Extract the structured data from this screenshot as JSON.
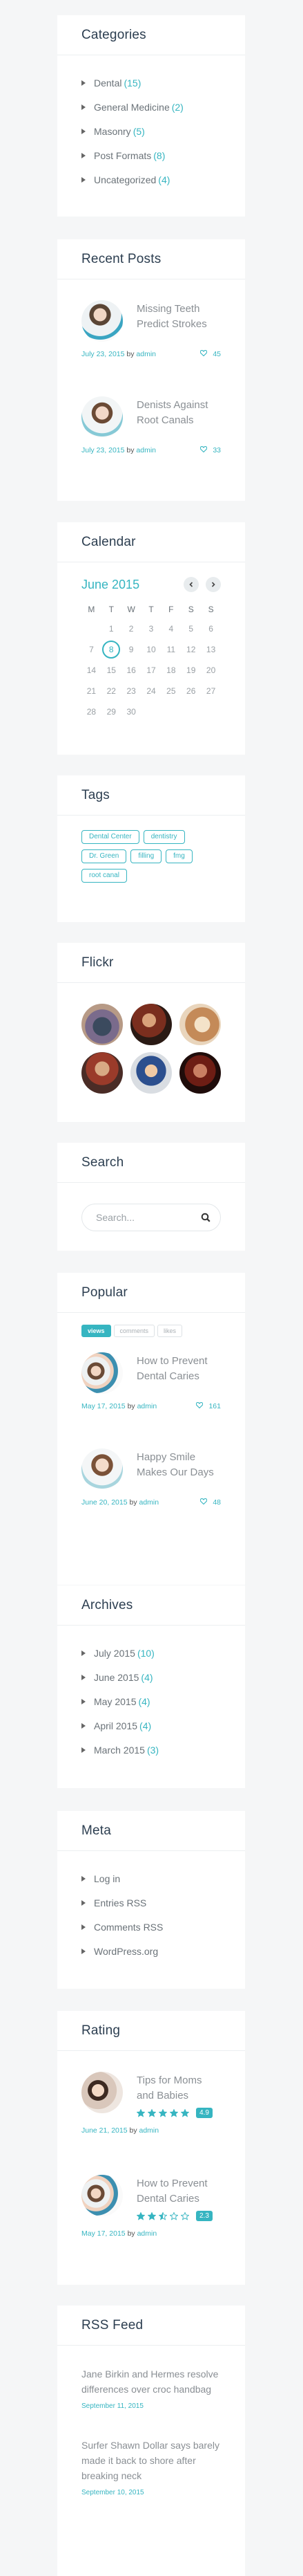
{
  "categories": {
    "title": "Categories",
    "items": [
      {
        "label": "Dental",
        "count": "(15)"
      },
      {
        "label": "General Medicine",
        "count": "(2)"
      },
      {
        "label": "Masonry",
        "count": "(5)"
      },
      {
        "label": "Post Formats",
        "count": "(8)"
      },
      {
        "label": "Uncategorized",
        "count": "(4)"
      }
    ]
  },
  "recent_posts": {
    "title": "Recent Posts",
    "posts": [
      {
        "title": "Missing Teeth Predict Strokes",
        "date": "July 23, 2015",
        "by": "by",
        "author": "admin",
        "likes": "45"
      },
      {
        "title": "Denists Against Root Canals",
        "date": "July 23, 2015",
        "by": "by",
        "author": "admin",
        "likes": "33"
      }
    ]
  },
  "calendar": {
    "title": "Calendar",
    "month": "June 2015",
    "prev_icon": "chevron-left-icon",
    "next_icon": "chevron-right-icon",
    "day_names": [
      "M",
      "T",
      "W",
      "T",
      "F",
      "S",
      "S"
    ],
    "weeks": [
      [
        "",
        "",
        "",
        "",
        "",
        "",
        ""
      ],
      [
        "",
        "1",
        "2",
        "3",
        "4",
        "5",
        "6"
      ],
      [
        "7",
        "8",
        "9",
        "10",
        "11",
        "12",
        "13"
      ],
      [
        "14",
        "15",
        "16",
        "17",
        "18",
        "19",
        "20"
      ],
      [
        "21",
        "22",
        "23",
        "24",
        "25",
        "26",
        "27"
      ],
      [
        "28",
        "29",
        "30",
        "",
        "",
        "",
        ""
      ]
    ],
    "today": "8"
  },
  "tags": {
    "title": "Tags",
    "items": [
      "Dental Center",
      "dentistry",
      "Dr. Green",
      "filling",
      "fmg",
      "root canal"
    ]
  },
  "flickr": {
    "title": "Flickr"
  },
  "search": {
    "title": "Search",
    "placeholder": "Search...",
    "icon": "search-icon"
  },
  "popular": {
    "title": "Popular",
    "tabs": [
      "views",
      "comments",
      "likes"
    ],
    "active_tab": "views",
    "posts": [
      {
        "title": "How to Prevent Dental Caries",
        "date": "May 17, 2015",
        "by": "by",
        "author": "admin",
        "likes": "161"
      },
      {
        "title": "Happy Smile Makes Our Days",
        "date": "June 20, 2015",
        "by": "by",
        "author": "admin",
        "likes": "48"
      }
    ]
  },
  "archives": {
    "title": "Archives",
    "items": [
      {
        "label": "July 2015",
        "count": "(10)"
      },
      {
        "label": "June 2015",
        "count": "(4)"
      },
      {
        "label": "May 2015",
        "count": "(4)"
      },
      {
        "label": "April 2015",
        "count": "(4)"
      },
      {
        "label": "March 2015",
        "count": "(3)"
      }
    ]
  },
  "meta": {
    "title": "Meta",
    "items": [
      "Log in",
      "Entries RSS",
      "Comments RSS",
      "WordPress.org"
    ]
  },
  "rating": {
    "title": "Rating",
    "posts": [
      {
        "title": "Tips for Moms and Babies",
        "stars": 5,
        "score": "4.9",
        "date": "June 21, 2015",
        "by": "by",
        "author": "admin"
      },
      {
        "title": "How to Prevent Dental Caries",
        "stars": 2.5,
        "score": "2.3",
        "date": "May 17, 2015",
        "by": "by",
        "author": "admin"
      }
    ]
  },
  "rss": {
    "title": "RSS Feed",
    "items": [
      {
        "title": "Jane Birkin and Hermes resolve differences over croc handbag",
        "date": "September 11, 2015"
      },
      {
        "title": "Surfer Shawn Dollar says barely made it back to shore after breaking neck",
        "date": "September 10, 2015"
      }
    ]
  },
  "colors": {
    "accent": "#36b5c1",
    "heading": "#2c3e50",
    "background": "#f5f6f7"
  }
}
